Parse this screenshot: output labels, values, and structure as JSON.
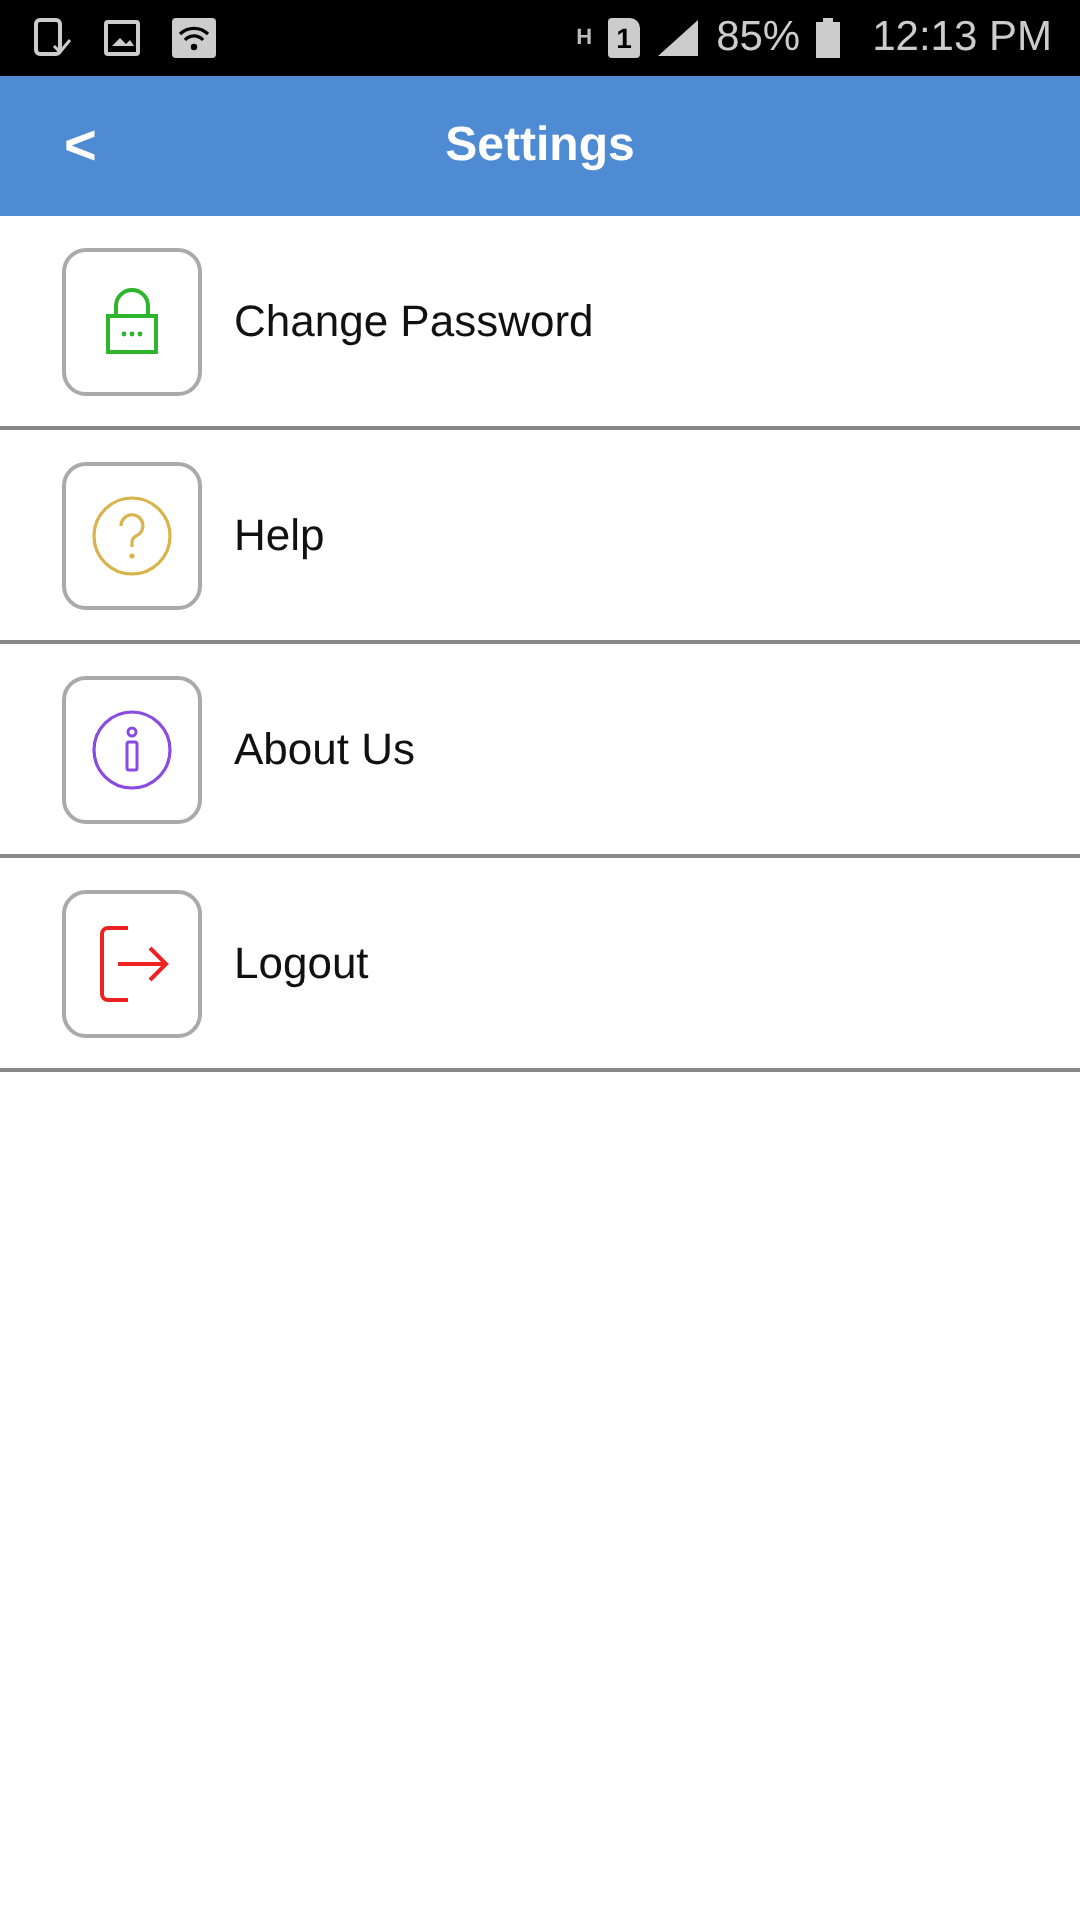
{
  "status_bar": {
    "network_type": "H",
    "sim": "1",
    "battery": "85%",
    "time": "12:13 PM"
  },
  "app_bar": {
    "back": "<",
    "title": "Settings"
  },
  "items": [
    {
      "label": "Change Password",
      "kind": "lock",
      "color": "#2db52d"
    },
    {
      "label": "Help",
      "kind": "help",
      "color": "#d9b44a"
    },
    {
      "label": "About Us",
      "kind": "info",
      "color": "#8a4be0"
    },
    {
      "label": "Logout",
      "kind": "logout",
      "color": "#ee2222"
    }
  ]
}
